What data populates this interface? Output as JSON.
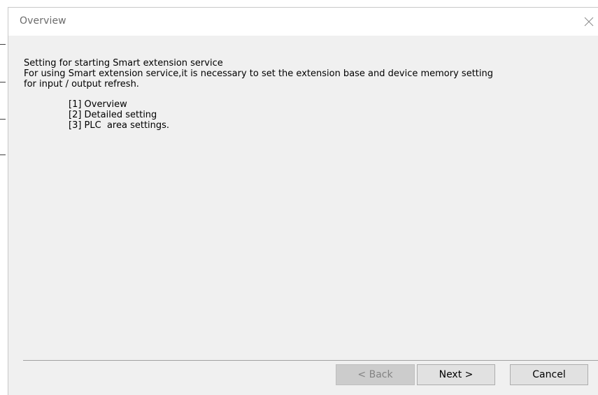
{
  "dialog": {
    "title": "Overview",
    "close_icon": "close-icon"
  },
  "content": {
    "heading": "Setting for starting Smart extension service",
    "description_line1": "For using Smart extension service,it is necessary to set the extension base and device memory setting",
    "description_line2": "for input / output refresh.",
    "steps": [
      {
        "label": "[1] Overview"
      },
      {
        "label": "[2] Detailed setting"
      },
      {
        "label": "[3] PLC  area settings."
      }
    ]
  },
  "buttons": {
    "back_label": "< Back",
    "next_label": "Next >",
    "cancel_label": "Cancel"
  },
  "colors": {
    "dialog_background": "#f0f0f0",
    "titlebar_background": "#ffffff",
    "disabled_button": "#cccccc",
    "button_face": "#e1e1e1"
  }
}
